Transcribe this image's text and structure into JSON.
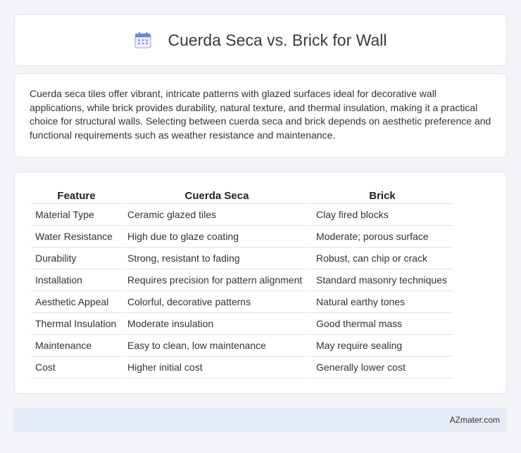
{
  "header": {
    "title": "Cuerda Seca vs. Brick for Wall",
    "icon": "calendar-icon"
  },
  "intro": {
    "text": "Cuerda seca tiles offer vibrant, intricate patterns with glazed surfaces ideal for decorative wall applications, while brick provides durability, natural texture, and thermal insulation, making it a practical choice for structural walls. Selecting between cuerda seca and brick depends on aesthetic preference and functional requirements such as weather resistance and maintenance."
  },
  "table": {
    "headers": [
      "Feature",
      "Cuerda Seca",
      "Brick"
    ],
    "rows": [
      [
        "Material Type",
        "Ceramic glazed tiles",
        "Clay fired blocks"
      ],
      [
        "Water Resistance",
        "High due to glaze coating",
        "Moderate; porous surface"
      ],
      [
        "Durability",
        "Strong, resistant to fading",
        "Robust, can chip or crack"
      ],
      [
        "Installation",
        "Requires precision for pattern alignment",
        "Standard masonry techniques"
      ],
      [
        "Aesthetic Appeal",
        "Colorful, decorative patterns",
        "Natural earthy tones"
      ],
      [
        "Thermal Insulation",
        "Moderate insulation",
        "Good thermal mass"
      ],
      [
        "Maintenance",
        "Easy to clean, low maintenance",
        "May require sealing"
      ],
      [
        "Cost",
        "Higher initial cost",
        "Generally lower cost"
      ]
    ]
  },
  "footer": {
    "brand": "AZmater.com"
  },
  "colors": {
    "background": "#f3f4f8",
    "card": "#ffffff",
    "footer_bg": "#e6ecf7",
    "icon_accent": "#7b7fd6"
  }
}
